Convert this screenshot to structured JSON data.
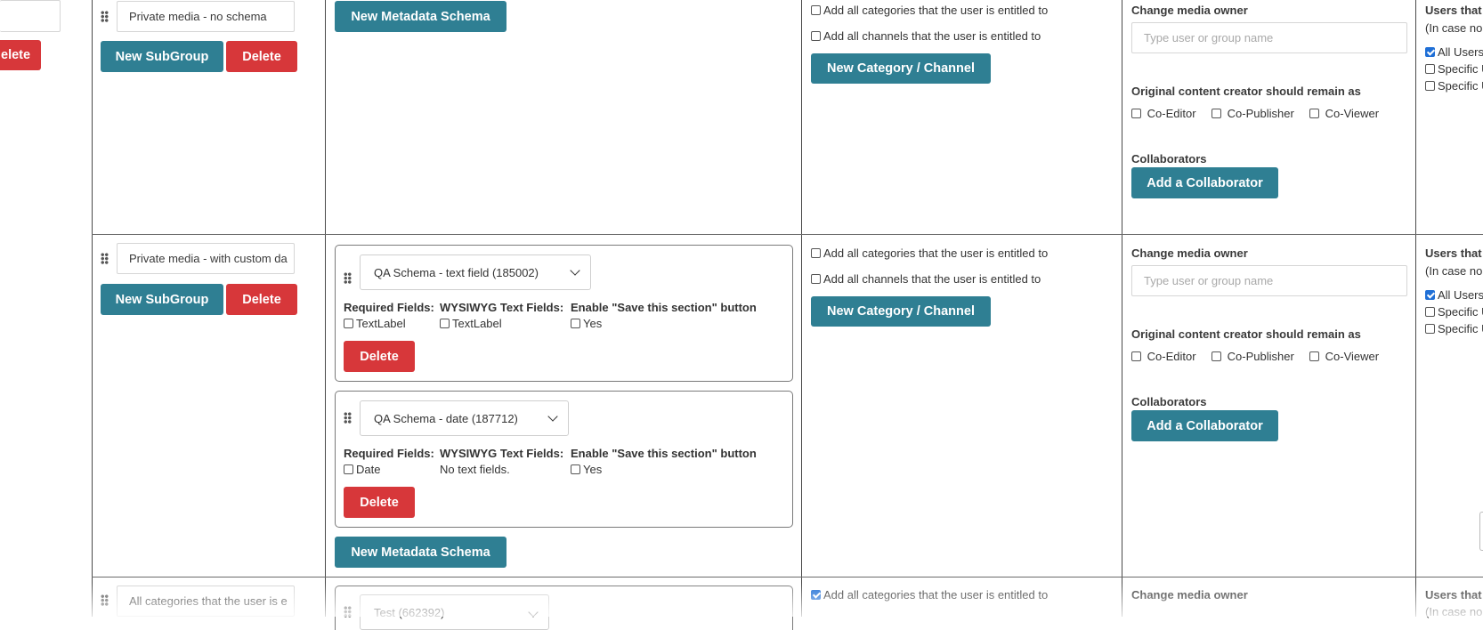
{
  "left": {
    "delete_label": "elete"
  },
  "shared": {
    "new_subgroup": "New SubGroup",
    "delete": "Delete",
    "new_metadata_schema": "New Metadata Schema",
    "add_all_categories": "Add all categories that the user is entitled to",
    "add_all_channels": "Add all channels that the user is entitled to",
    "new_category_channel": "New Category / Channel",
    "change_media_owner": "Change media owner",
    "owner_placeholder": "Type user or group name",
    "original_creator_remain": "Original content creator should remain as",
    "co_editor": "Co-Editor",
    "co_publisher": "Co-Publisher",
    "co_viewer": "Co-Viewer",
    "collaborators": "Collaborators",
    "add_collaborator": "Add a Collaborator",
    "users_that": "Users that",
    "in_case_no": "(In case no",
    "all_users": "All Users",
    "specific_1": "Specific U",
    "specific_2": "Specific U",
    "required_fields": "Required Fields:",
    "wysiwyg_fields": "WYSIWYG Text Fields:",
    "enable_save": "Enable \"Save this section\" button",
    "yes": "Yes"
  },
  "rows": [
    {
      "group_name": "Private media - no schema"
    },
    {
      "group_name": "Private media - with custom da",
      "schemas": [
        {
          "name": "QA Schema - text field (185002)",
          "required_field": "TextLabel",
          "wysiwyg_field": "TextLabel"
        },
        {
          "name": "QA Schema - date (187712)",
          "required_field": "Date",
          "no_text_fields": "No text fields."
        }
      ]
    },
    {
      "group_name": "All categories that the user is e",
      "schema_name": "Test (662392)"
    }
  ],
  "colors": {
    "teal": "#2f7f93",
    "red": "#d7373a",
    "check_blue": "#1f6fd6"
  }
}
